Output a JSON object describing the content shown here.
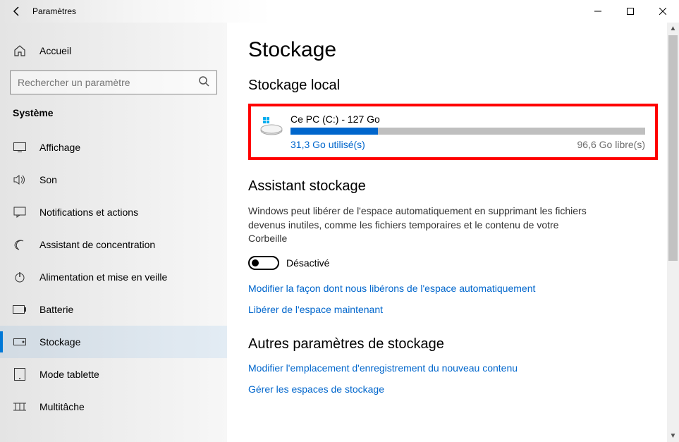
{
  "titlebar": {
    "title": "Paramètres"
  },
  "sidebar": {
    "home_label": "Accueil",
    "search_placeholder": "Rechercher un paramètre",
    "section_label": "Système",
    "items": [
      {
        "label": "Affichage"
      },
      {
        "label": "Son"
      },
      {
        "label": "Notifications et actions"
      },
      {
        "label": "Assistant de concentration"
      },
      {
        "label": "Alimentation et mise en veille"
      },
      {
        "label": "Batterie"
      },
      {
        "label": "Stockage"
      },
      {
        "label": "Mode tablette"
      },
      {
        "label": "Multitâche"
      }
    ]
  },
  "content": {
    "page_title": "Stockage",
    "local_storage_heading": "Stockage local",
    "disk": {
      "title": "Ce PC (C:) - 127 Go",
      "used": "31,3 Go utilisé(s)",
      "free": "96,6 Go libre(s)"
    },
    "storage_sense_heading": "Assistant stockage",
    "storage_sense_text": "Windows peut libérer de l'espace automatiquement en supprimant les fichiers devenus inutiles, comme les fichiers temporaires et le contenu de votre Corbeille",
    "toggle_label": "Désactivé",
    "link_configure": "Modifier la façon dont nous libérons de l'espace automatiquement",
    "link_free_now": "Libérer de l'espace maintenant",
    "other_heading": "Autres paramètres de stockage",
    "link_save_locations": "Modifier l'emplacement d'enregistrement du nouveau contenu",
    "link_manage_spaces": "Gérer les espaces de stockage"
  }
}
